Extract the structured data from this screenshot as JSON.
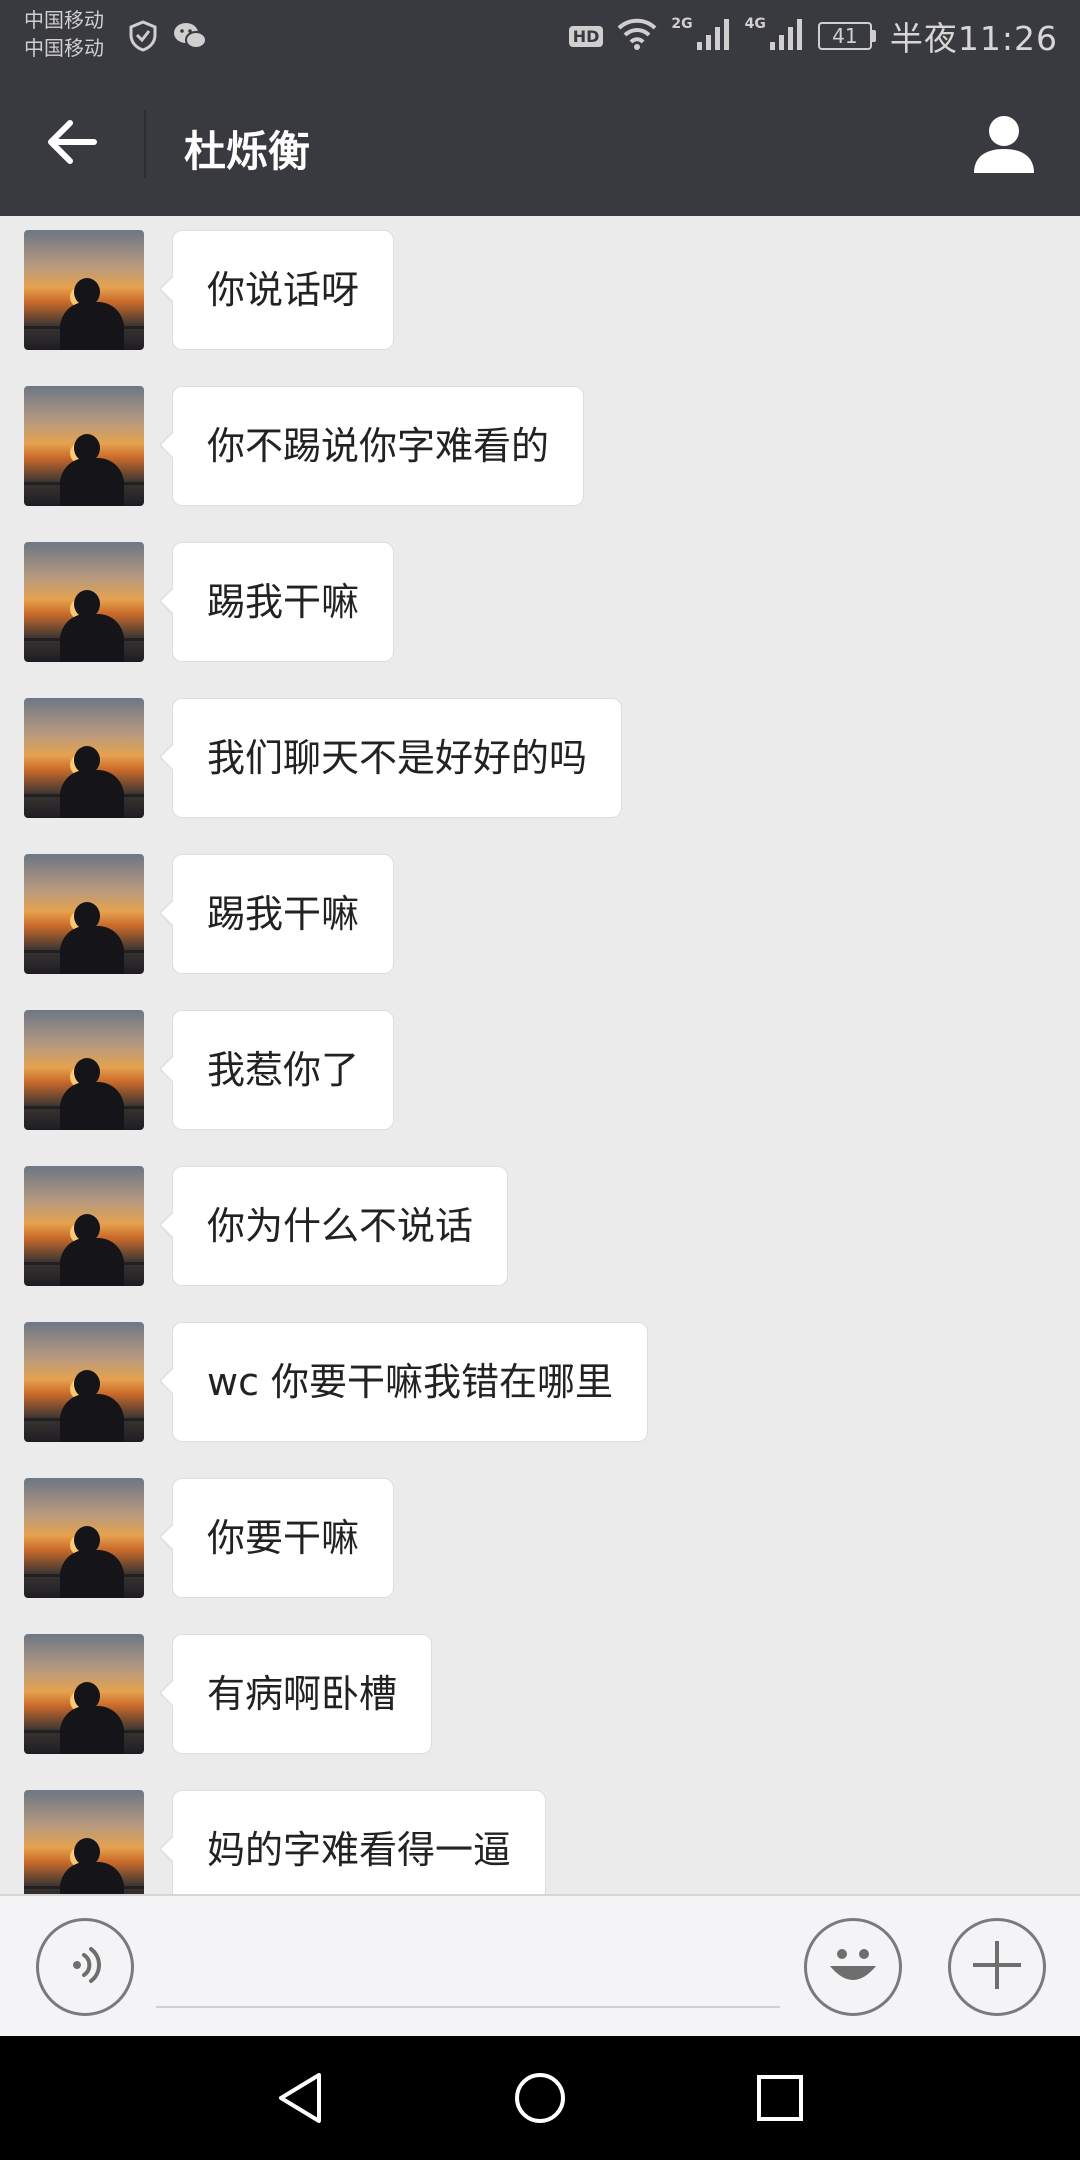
{
  "status_bar": {
    "carrier_1": "中国移动",
    "carrier_2": "中国移动",
    "hd": "HD",
    "net_2g": "2G",
    "net_4g": "4G",
    "battery": "41",
    "time": "半夜11:26"
  },
  "header": {
    "title": "杜烁衡",
    "back_icon": "back-arrow-icon",
    "profile_icon": "person-icon"
  },
  "messages": [
    {
      "text": "你说话呀"
    },
    {
      "text": "你不踢说你字难看的"
    },
    {
      "text": "踢我干嘛"
    },
    {
      "text": "我们聊天不是好好的吗"
    },
    {
      "text": "踢我干嘛"
    },
    {
      "text": "我惹你了"
    },
    {
      "text": "你为什么不说话"
    },
    {
      "text": "wc 你要干嘛我错在哪里"
    },
    {
      "text": "你要干嘛"
    },
    {
      "text": "有病啊卧槽"
    },
    {
      "text": "妈的字难看得一逼"
    }
  ],
  "input_bar": {
    "voice_icon": "voice-icon",
    "emoji_icon": "emoji-icon",
    "plus_icon": "plus-icon",
    "value": ""
  },
  "nav_bar": {
    "back": "nav-back-icon",
    "home": "nav-home-icon",
    "recent": "nav-recent-icon"
  }
}
